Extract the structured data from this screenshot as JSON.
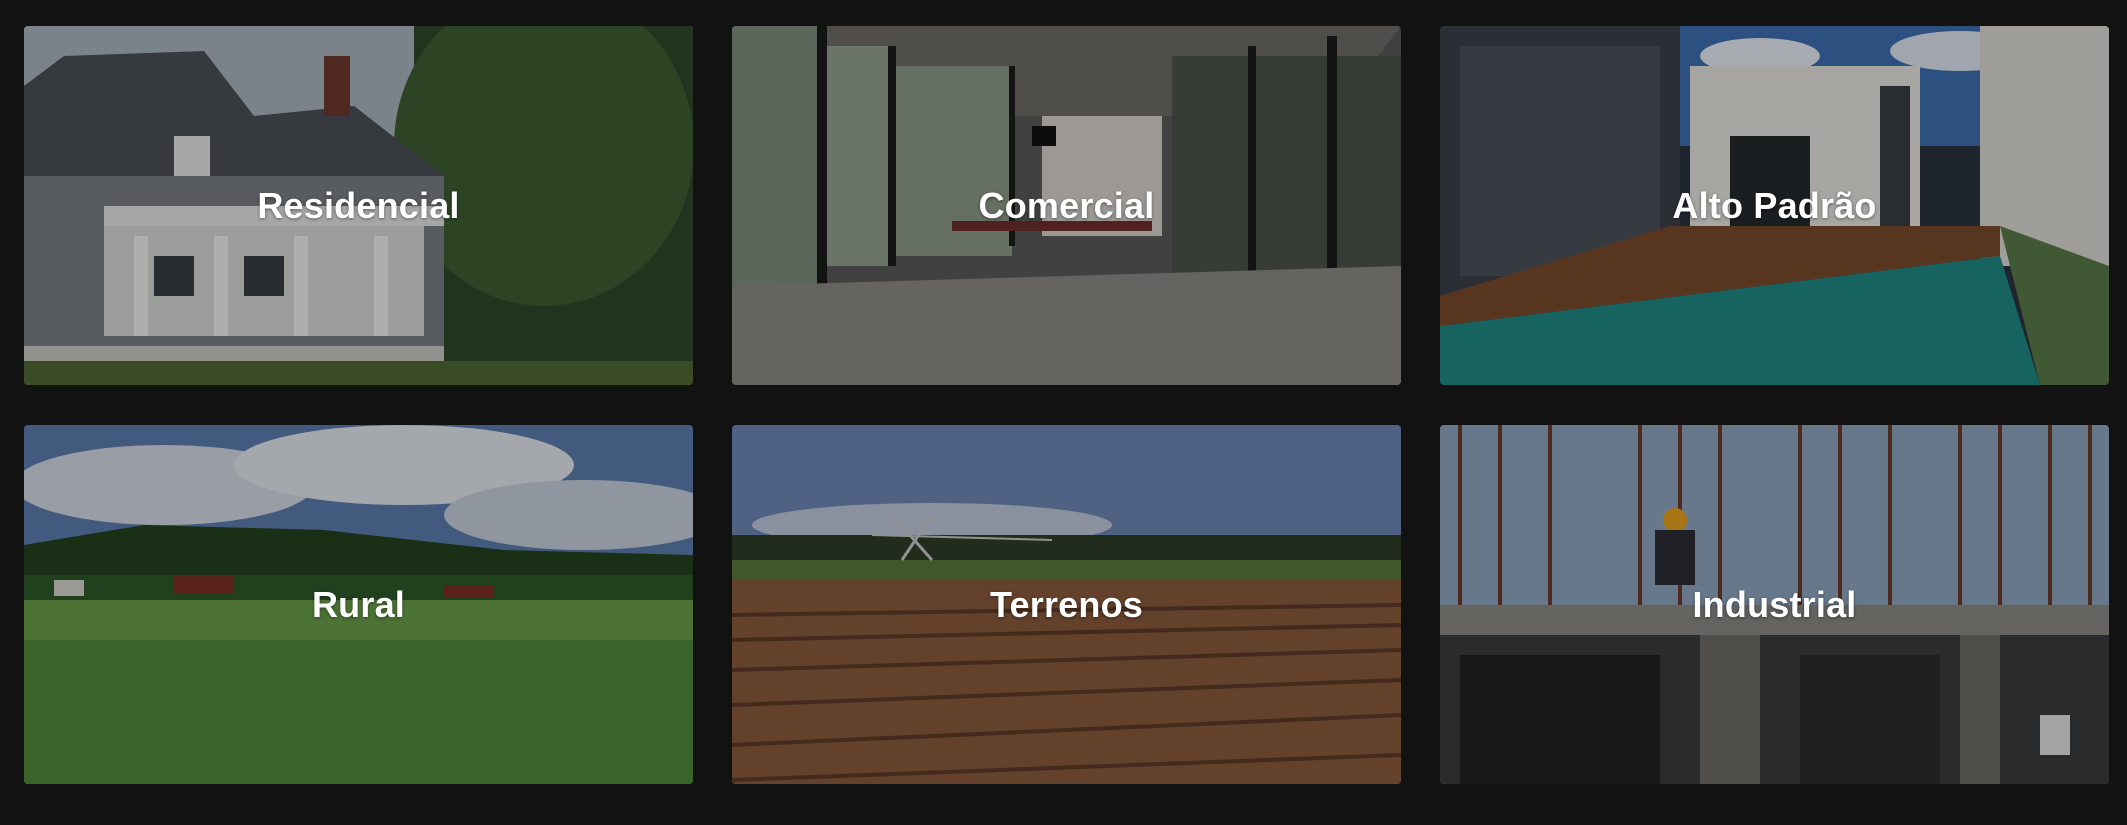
{
  "categories": [
    {
      "label": "Residencial",
      "image": "house-with-porch-photo"
    },
    {
      "label": "Comercial",
      "image": "glass-office-interior-photo"
    },
    {
      "label": "Alto Padrão",
      "image": "house-with-pool-photo"
    },
    {
      "label": "Rural",
      "image": "green-field-farm-photo"
    },
    {
      "label": "Terrenos",
      "image": "plowed-land-photo"
    },
    {
      "label": "Industrial",
      "image": "construction-site-photo"
    }
  ]
}
